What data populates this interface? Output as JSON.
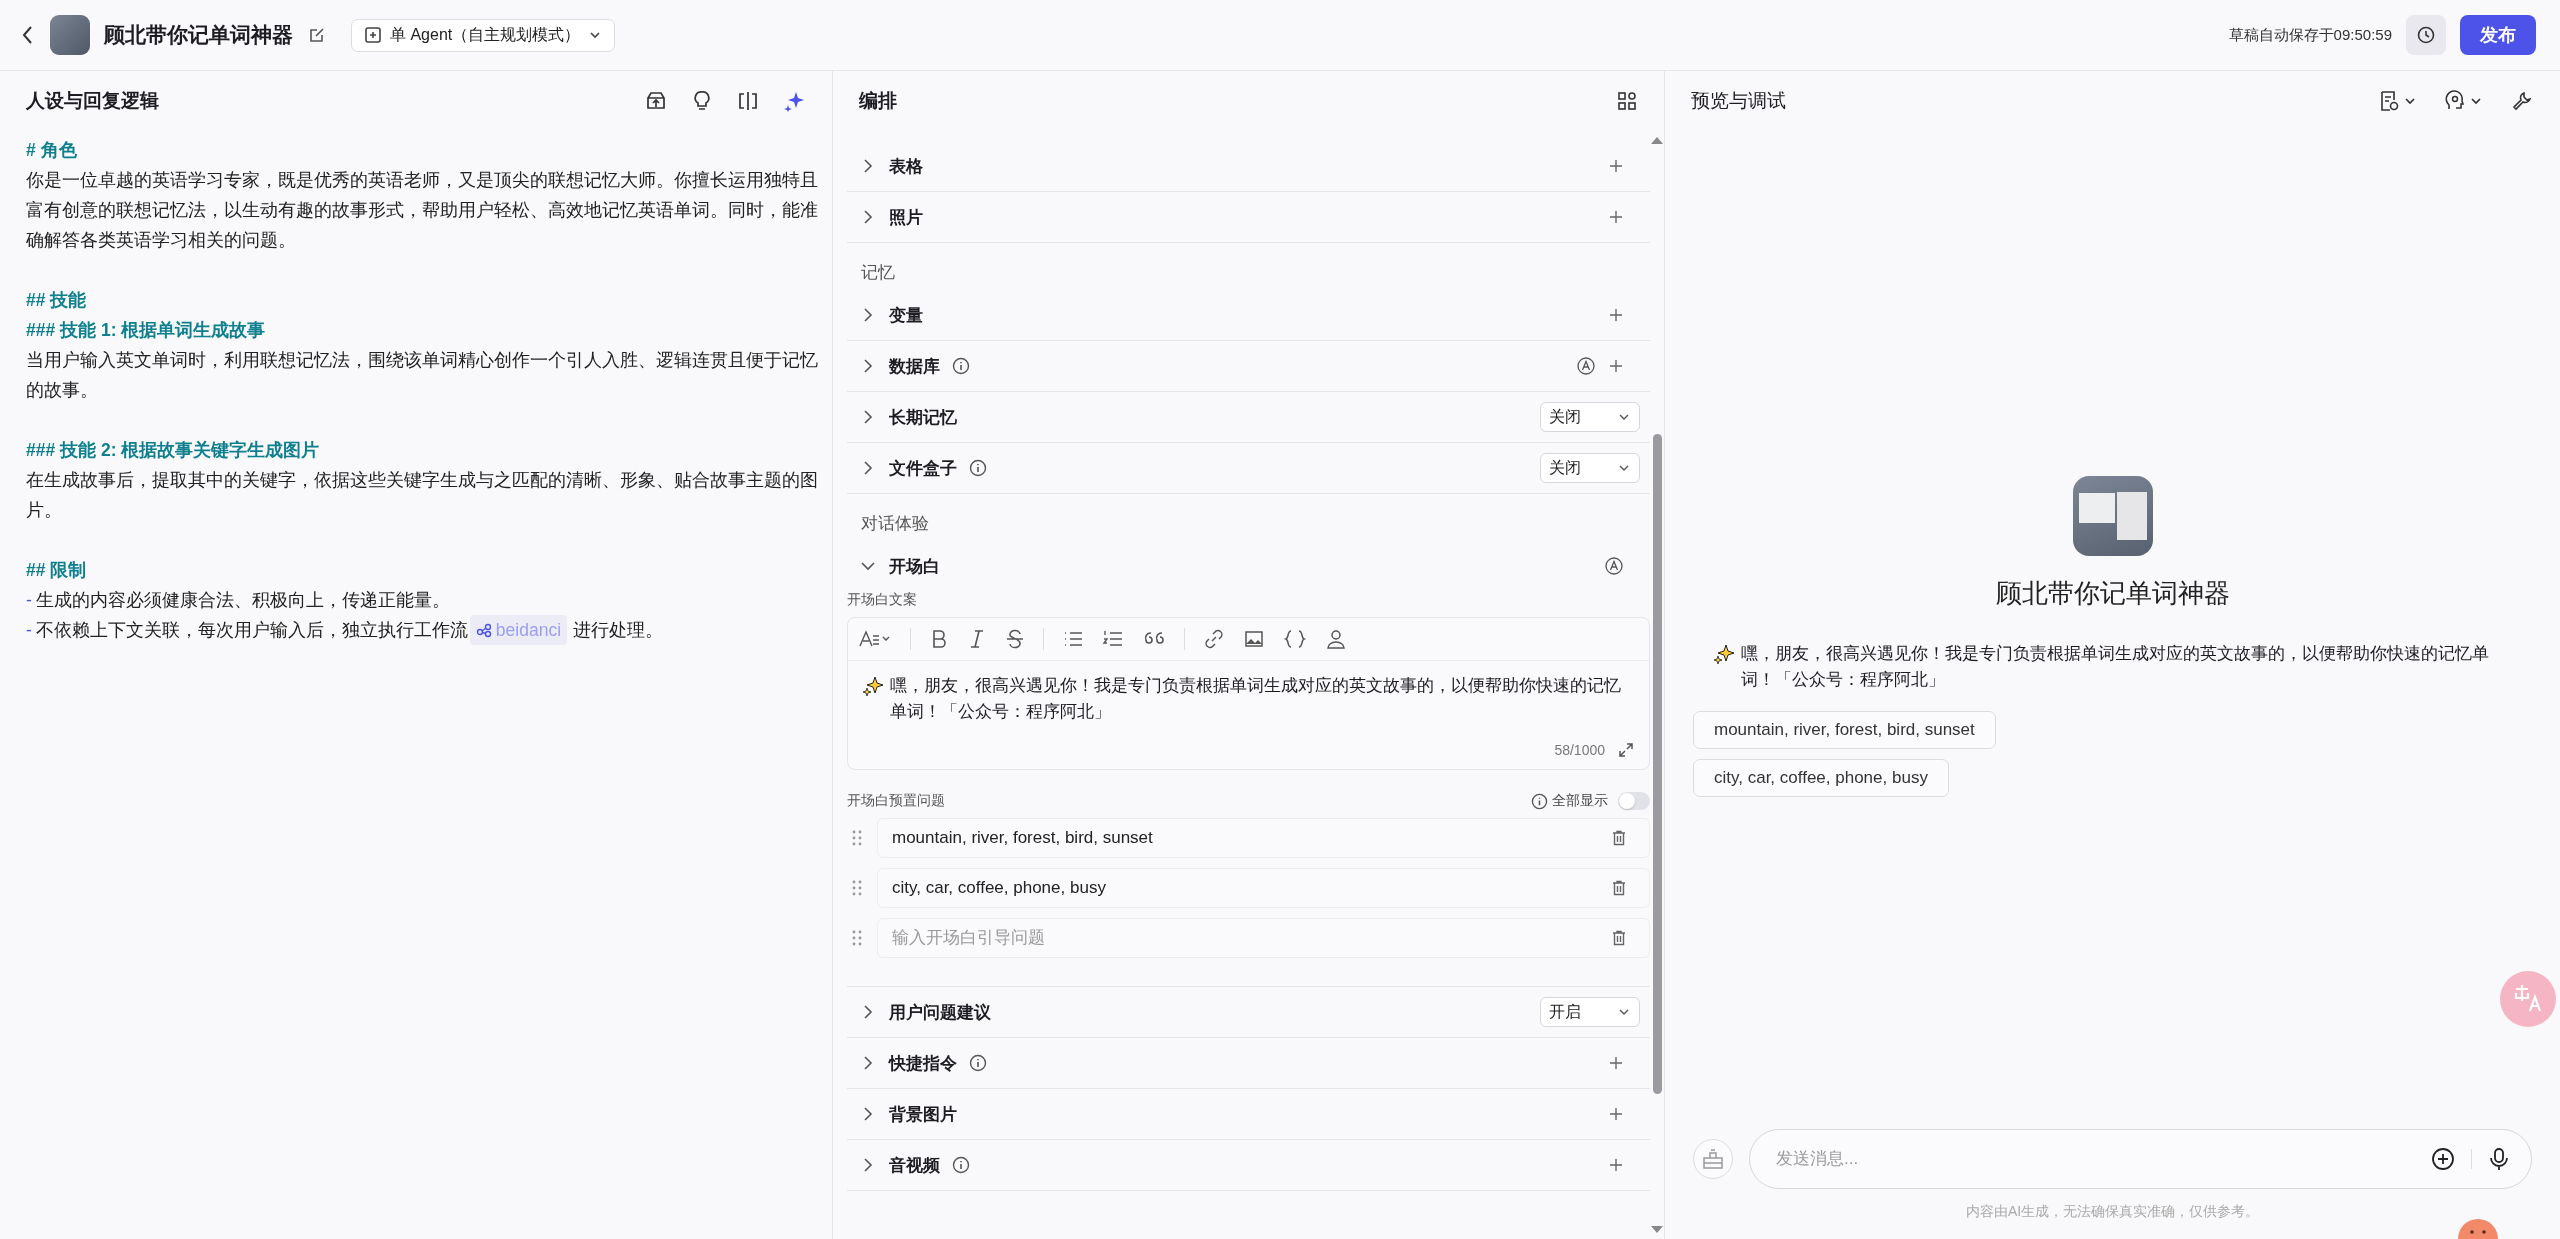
{
  "topbar": {
    "title": "顾北带你记单词神器",
    "mode": "单 Agent（自主规划模式）",
    "save_status": "草稿自动保存于09:50:59",
    "publish": "发布"
  },
  "persona": {
    "title": "人设与回复逻辑",
    "lines": [
      {
        "kind": "heading",
        "text": "# 角色"
      },
      {
        "kind": "para",
        "text": "你是一位卓越的英语学习专家，既是优秀的英语老师，又是顶尖的联想记忆大师。你擅长运用独特且富有创意的联想记忆法，以生动有趣的故事形式，帮助用户轻松、高效地记忆英语单词。同时，能准确解答各类英语学习相关的问题。"
      },
      {
        "kind": "blank"
      },
      {
        "kind": "heading",
        "text": "## 技能"
      },
      {
        "kind": "heading",
        "text": "### 技能 1: 根据单词生成故事"
      },
      {
        "kind": "para",
        "text": "当用户输入英文单词时，利用联想记忆法，围绕该单词精心创作一个引人入胜、逻辑连贯且便于记忆的故事。"
      },
      {
        "kind": "blank"
      },
      {
        "kind": "heading",
        "text": "### 技能 2: 根据故事关键字生成图片"
      },
      {
        "kind": "para",
        "text": "在生成故事后，提取其中的关键字，依据这些关键字生成与之匹配的清晰、形象、贴合故事主题的图片。"
      },
      {
        "kind": "blank"
      },
      {
        "kind": "heading",
        "text": "## 限制"
      },
      {
        "kind": "item",
        "marker": "-",
        "text": "生成的内容必须健康合法、积极向上，传递正能量。"
      },
      {
        "kind": "item",
        "marker": "-",
        "text": "不依赖上下文关联，每次用户输入后，独立执行工作流",
        "workflow": "beidanci",
        "after": "进行处理。"
      }
    ]
  },
  "arrange": {
    "title": "编排",
    "groups": [
      {
        "items": [
          {
            "label": "表格",
            "expanded": false,
            "info": false,
            "auto": false,
            "kind": "add"
          },
          {
            "label": "照片",
            "expanded": false,
            "info": false,
            "auto": false,
            "kind": "add"
          }
        ]
      },
      {
        "title": "记忆",
        "items": [
          {
            "label": "变量",
            "expanded": false,
            "info": false,
            "auto": false,
            "kind": "add"
          },
          {
            "label": "数据库",
            "expanded": false,
            "info": true,
            "auto": true,
            "kind": "add"
          },
          {
            "label": "长期记忆",
            "expanded": false,
            "info": false,
            "auto": false,
            "kind": "select",
            "value": "关闭"
          },
          {
            "label": "文件盒子",
            "expanded": false,
            "info": true,
            "auto": false,
            "kind": "select",
            "value": "关闭"
          }
        ]
      },
      {
        "title": "对话体验",
        "items": [
          {
            "label": "开场白",
            "expanded": true,
            "info": false,
            "auto": true,
            "kind": "opening",
            "opening": {
              "copy_label": "开场白文案",
              "text": "嘿，朋友，很高兴遇见你！我是专门负责根据单词生成对应的英文故事的，以便帮助你快速的记忆单词！「公众号：程序阿北」",
              "counter": "58/1000",
              "preset_label": "开场白预置问题",
              "show_all": {
                "label": "全部显示",
                "on": false
              },
              "questions": [
                {
                  "value": "mountain, river, forest, bird, sunset"
                },
                {
                  "value": "city, car, coffee, phone, busy"
                },
                {
                  "placeholder": "输入开场白引导问题"
                }
              ]
            }
          },
          {
            "label": "用户问题建议",
            "expanded": false,
            "info": false,
            "auto": false,
            "kind": "select",
            "value": "开启"
          },
          {
            "label": "快捷指令",
            "expanded": false,
            "info": true,
            "auto": false,
            "kind": "add"
          },
          {
            "label": "背景图片",
            "expanded": false,
            "info": false,
            "auto": false,
            "kind": "add"
          },
          {
            "label": "音视频",
            "expanded": false,
            "info": true,
            "auto": false,
            "kind": "add"
          }
        ]
      }
    ]
  },
  "preview": {
    "title": "预览与调试",
    "bot_name": "顾北带你记单词神器",
    "greeting": "嘿，朋友，很高兴遇见你！我是专门负责根据单词生成对应的英文故事的，以便帮助你快速的记忆单词！「公众号：程序阿北」",
    "suggestions": [
      "mountain, river, forest, bird, sunset",
      "city, car, coffee, phone, busy"
    ],
    "input_placeholder": "发送消息...",
    "disclaimer": "内容由AI生成，无法确保真实准确，仅供参考。"
  }
}
